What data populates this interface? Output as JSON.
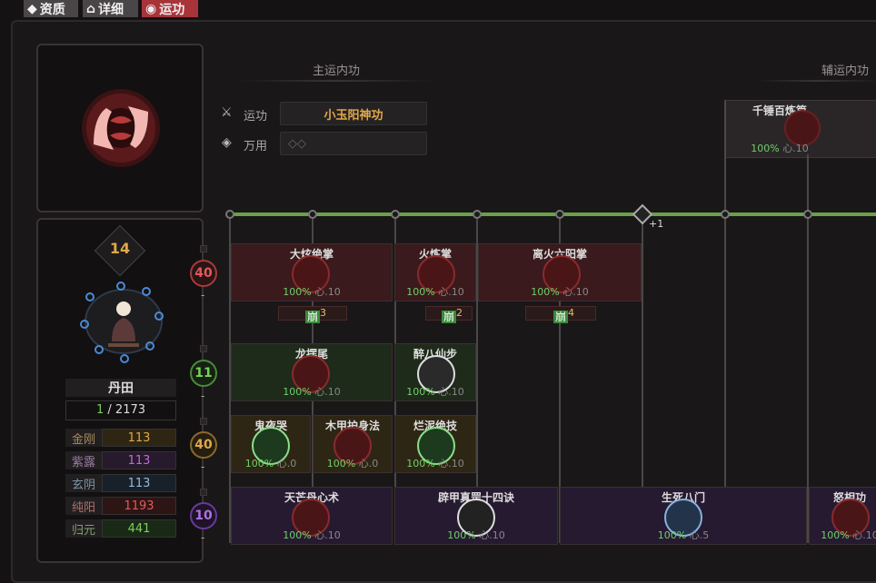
{
  "tabs": [
    {
      "label": "资质",
      "icon": "diamond-icon",
      "active": false
    },
    {
      "label": "详细",
      "icon": "speech-icon",
      "active": false
    },
    {
      "label": "运功",
      "icon": "location-pin-icon",
      "active": true
    }
  ],
  "sections": {
    "main": "主运内功",
    "aux": "辅运内功"
  },
  "main_skill": {
    "label": "运功",
    "value": "小玉阳神功"
  },
  "universal": {
    "label": "万用",
    "value": "◇◇"
  },
  "aux_skill": {
    "name": "千锤百炼篇",
    "pct": "100%",
    "xin": "心.10"
  },
  "track_bonus": "+1",
  "character": {
    "level": "14",
    "dantian_label": "丹田",
    "dantian_current": "1",
    "dantian_max": "/ 2173"
  },
  "stats": [
    {
      "label": "金刚",
      "value": "113",
      "color": "#e0a84a",
      "bg": "#3a2f14"
    },
    {
      "label": "紫露",
      "value": "113",
      "color": "#c06ad6",
      "bg": "#2c1d33"
    },
    {
      "label": "玄阴",
      "value": "113",
      "color": "#6aaed6",
      "bg": "#1b2733"
    },
    {
      "label": "纯阳",
      "value": "1193",
      "color": "#e05a5a",
      "bg": "#3a1818"
    },
    {
      "label": "归元",
      "value": "441",
      "color": "#7ad05a",
      "bg": "#1c2e17"
    }
  ],
  "row_levels": [
    {
      "value": "40",
      "color": "#e05a5a"
    },
    {
      "value": "11",
      "color": "#7ad05a"
    },
    {
      "value": "40",
      "color": "#e0a84a"
    },
    {
      "value": "10",
      "color": "#b070e0"
    }
  ],
  "skills": {
    "r1": [
      {
        "name": "大炫绝掌",
        "pct": "100%",
        "xin": "心.10"
      },
      {
        "name": "火炼掌",
        "pct": "100%",
        "xin": "心.10"
      },
      {
        "name": "离火六阳掌",
        "pct": "100%",
        "xin": "心.10"
      }
    ],
    "r1_tags": [
      {
        "label": "崩",
        "num": "3"
      },
      {
        "label": "崩",
        "num": "2"
      },
      {
        "label": "崩",
        "num": "4"
      }
    ],
    "r2": [
      {
        "name": "龙摆尾",
        "pct": "100%",
        "xin": "心.10"
      },
      {
        "name": "醉八仙步",
        "pct": "100%",
        "xin": "心.10"
      }
    ],
    "r3": [
      {
        "name": "鬼夜哭",
        "pct": "100%",
        "xin": "心.0"
      },
      {
        "name": "木甲护身法",
        "pct": "100%",
        "xin": "心.0"
      },
      {
        "name": "烂泥绝技",
        "pct": "100%",
        "xin": "心.10"
      }
    ],
    "r4": [
      {
        "name": "天芒丹心术",
        "pct": "100%",
        "xin": "心.10"
      },
      {
        "name": "辟甲真罡十四诀",
        "pct": "100%",
        "xin": "心.10"
      },
      {
        "name": "生死八门",
        "pct": "100%",
        "xin": "心.5"
      },
      {
        "name": "怒相功",
        "pct": "100%",
        "xin": "心.10"
      }
    ]
  }
}
